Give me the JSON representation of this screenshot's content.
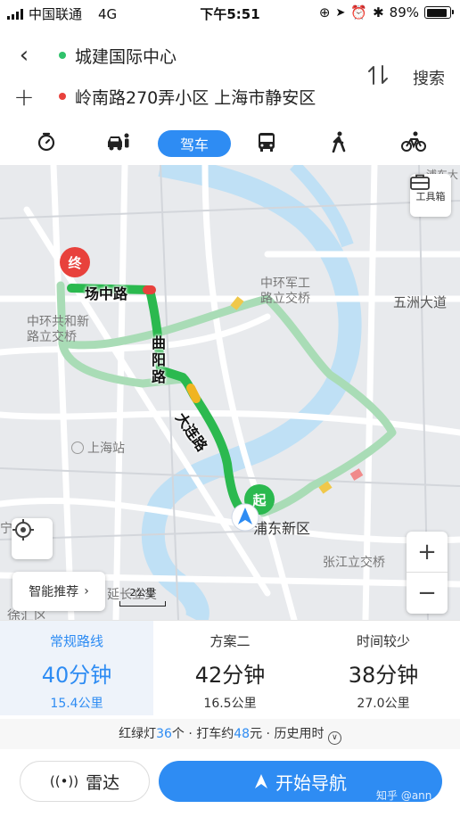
{
  "status_bar": {
    "carrier": "中国联通",
    "network": "4G",
    "time": "下午5:51",
    "battery": "89%",
    "battery_level": 0.89
  },
  "route_header": {
    "origin": "城建国际中心",
    "destination": "岭南路270弄小区 上海市静安区",
    "search_label": "搜索",
    "colors": {
      "origin_dot": "#2fc26b",
      "destination_dot": "#e8413c"
    }
  },
  "transport_modes": [
    {
      "name": "timer",
      "icon": "stopwatch-icon"
    },
    {
      "name": "taxi",
      "icon": "car-person-icon"
    },
    {
      "name": "drive",
      "label": "驾车",
      "active": true
    },
    {
      "name": "bus",
      "icon": "bus-icon"
    },
    {
      "name": "walk",
      "icon": "walk-icon"
    },
    {
      "name": "bike",
      "icon": "bike-icon"
    }
  ],
  "map": {
    "toolbox_label": "工具箱",
    "end_marker": "终",
    "start_marker": "起",
    "smart_label": "智能推荐",
    "scale_label": "2公里",
    "zoom_in": "+",
    "zoom_out": "−",
    "road_labels": [
      "场中路",
      "曲阳路",
      "大连路"
    ],
    "place_labels": {
      "zhonghuan_junggong": "中环军工\n路立交桥",
      "wuzhou": "五洲大道",
      "zhonghuan_gonghe": "中环共和新\n路立交桥",
      "shanghai_station": "上海站",
      "pudong": "浦东新区",
      "zhangjiang": "张江立交桥",
      "xujiahui_partial": "徐汇区",
      "partial_left": "宁",
      "partial_top": "浦东大",
      "partial_bottom_mid": "延长立交"
    },
    "colors": {
      "route_main": "#2bb94f",
      "route_alt": "#a9dcb6",
      "water": "#bfe0f5",
      "land": "#e8eaed",
      "road": "#ffffff"
    }
  },
  "route_options": [
    {
      "title": "常规路线",
      "duration": "40分钟",
      "distance": "15.4公里",
      "selected": true
    },
    {
      "title": "方案二",
      "duration": "42分钟",
      "distance": "16.5公里",
      "selected": false
    },
    {
      "title": "时间较少",
      "duration": "38分钟",
      "distance": "27.0公里",
      "selected": false
    }
  ],
  "route_info": {
    "lights_prefix": "红绿灯",
    "lights_count": "36",
    "lights_suffix": "个 · 打车约",
    "taxi_fare": "48",
    "taxi_suffix": "元 · 历史用时"
  },
  "bottom": {
    "radar_label": "雷达",
    "start_label": "开始导航",
    "watermark": "知乎 @ann"
  },
  "accent_color": "#2e8cf3"
}
